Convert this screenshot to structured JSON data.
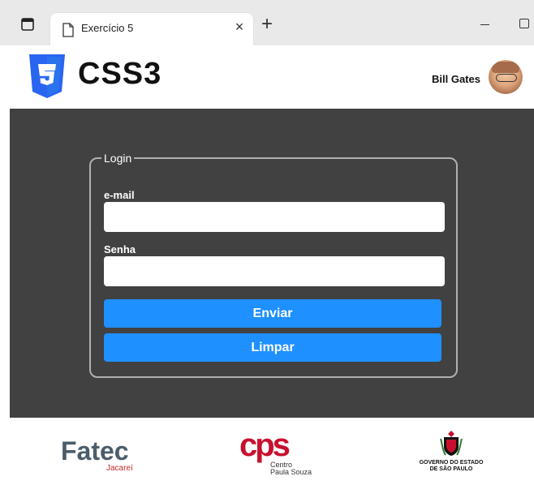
{
  "browser": {
    "tab_title": "Exercício 5",
    "close_glyph": "×",
    "newtab_glyph": "+"
  },
  "header": {
    "logo_badge": "3",
    "logo_text": "CSS3",
    "user_name": "Bill Gates"
  },
  "login": {
    "legend": "Login",
    "email_label": "e-mail",
    "email_value": "",
    "password_label": "Senha",
    "password_value": "",
    "submit_label": "Enviar",
    "reset_label": "Limpar"
  },
  "footer": {
    "fatec_name": "Fatec",
    "fatec_sub": "Jacareí",
    "cps_mark": "cps",
    "cps_line1": "Centro",
    "cps_line2": "Paula Souza",
    "gov_line1": "GOVERNO DO ESTADO",
    "gov_line2": "DE SÃO PAULO"
  },
  "colors": {
    "main_bg": "#414141",
    "button_bg": "#1e90ff",
    "css3_blue": "#2965f1",
    "cps_red": "#c8102e"
  }
}
